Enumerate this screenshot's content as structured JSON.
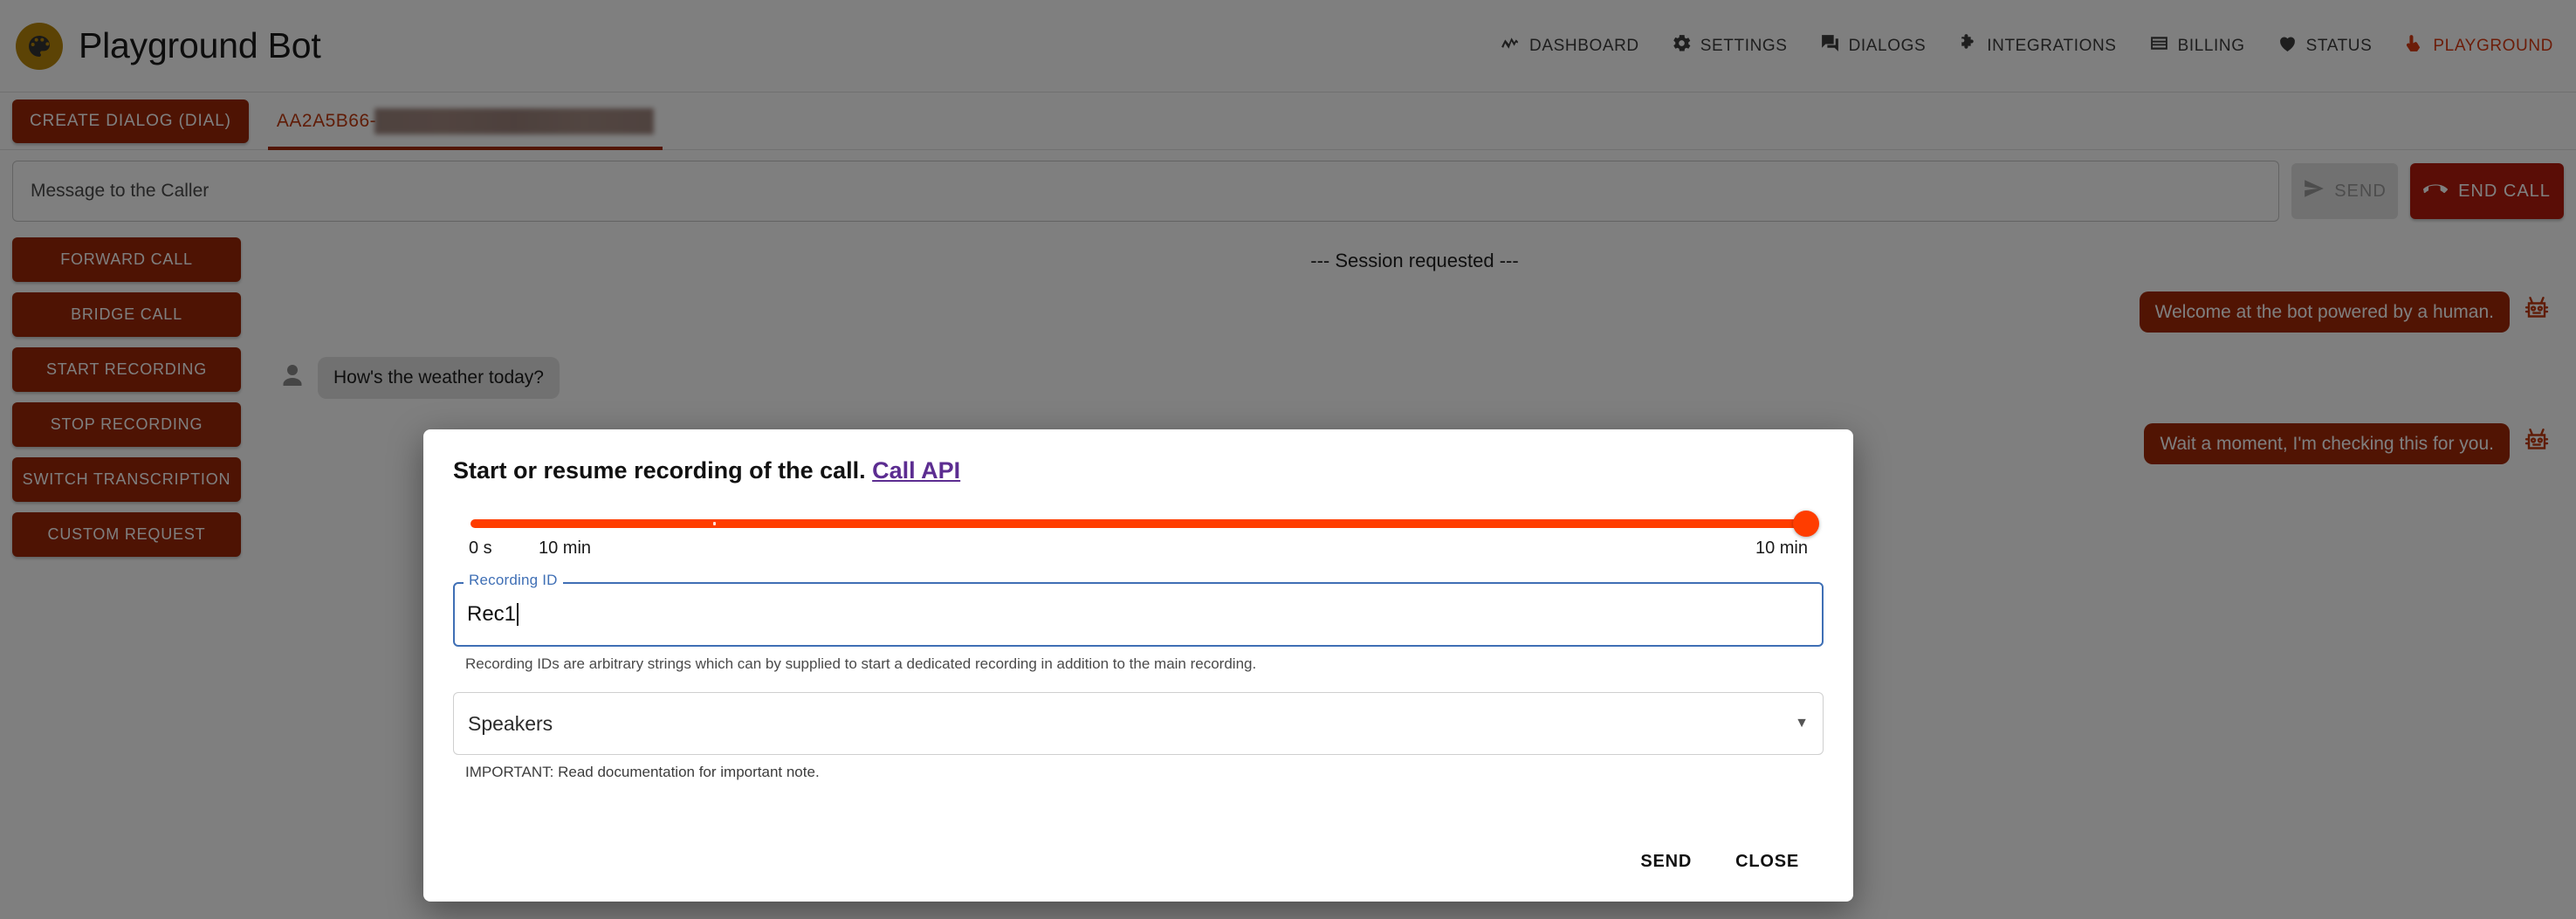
{
  "header": {
    "brand_title": "Playground Bot",
    "logo_icon": "palette-icon",
    "nav": [
      {
        "label": "DASHBOARD",
        "icon": "timeline-chart-icon",
        "active": false
      },
      {
        "label": "SETTINGS",
        "icon": "gear-icon",
        "active": false
      },
      {
        "label": "DIALOGS",
        "icon": "chat-bubble-icon",
        "active": false
      },
      {
        "label": "INTEGRATIONS",
        "icon": "puzzle-piece-icon",
        "active": false
      },
      {
        "label": "BILLING",
        "icon": "credit-card-icon",
        "active": false
      },
      {
        "label": "STATUS",
        "icon": "heart-icon",
        "active": false
      },
      {
        "label": "PLAYGROUND",
        "icon": "touch-hand-icon",
        "active": true
      }
    ]
  },
  "tabbar": {
    "create_dialog_label": "CREATE DIALOG (DIAL)",
    "active_tab_id": "AA2A5B66-"
  },
  "composer": {
    "message_placeholder": "Message to the Caller",
    "message_value": "",
    "send_label": "SEND",
    "send_icon": "paper-plane-icon",
    "end_call_label": "END CALL",
    "end_call_icon": "call-end-icon"
  },
  "sidebar": {
    "buttons": [
      "FORWARD CALL",
      "BRIDGE CALL",
      "START RECORDING",
      "STOP RECORDING",
      "SWITCH TRANSCRIPTION",
      "CUSTOM REQUEST"
    ]
  },
  "conversation": {
    "session_note": "--- Session requested ---",
    "messages": [
      {
        "sender": "bot",
        "text": "Welcome at the bot powered by a human.",
        "icon": "robot-face-icon"
      },
      {
        "sender": "user",
        "text": "How's the weather today?",
        "icon": "person-icon"
      },
      {
        "sender": "bot",
        "text": "Wait a moment, I'm checking this for you.",
        "icon": "robot-face-icon"
      }
    ]
  },
  "modal": {
    "title_text": "Start or resume recording of the call.",
    "api_link_label": "Call API",
    "slider": {
      "min_label": "0 s",
      "mid_label": "10 min",
      "max_label": "10 min",
      "value_percent": 100
    },
    "recording_id_field": {
      "label": "Recording ID",
      "value": "Rec1",
      "helper": "Recording IDs are arbitrary strings which can by supplied to start a dedicated recording in addition to the main recording."
    },
    "speakers_select": {
      "value": "Speakers",
      "arrow_icon": "chevron-down-icon",
      "note": "IMPORTANT: Read documentation for important note."
    },
    "send_label": "SEND",
    "close_label": "CLOSE"
  },
  "colors": {
    "brand_red": "#9c2706",
    "accent_red": "#c0390f",
    "end_call_red": "#b51b0c",
    "slider_orange": "#ff3d00",
    "focus_blue": "#3f6fb5",
    "link_purple": "#5c2d91",
    "logo_gold": "#b8860b"
  }
}
